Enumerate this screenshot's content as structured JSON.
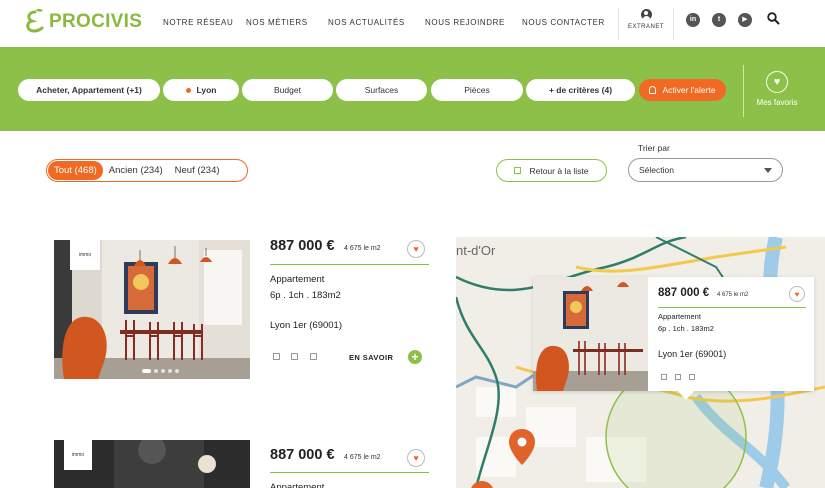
{
  "header": {
    "logo_text": "PROCIVIS",
    "nav": [
      "NOTRE RÉSEAU",
      "NOS MÉTIERS",
      "NOS ACTUALITÉS",
      "NOUS REJOINDRE",
      "NOUS CONTACTER"
    ],
    "extranet_label": "EXTRANET",
    "social_icons": [
      "linkedin-icon",
      "twitter-icon",
      "youtube-icon"
    ],
    "search_icon": "search-icon"
  },
  "filters": {
    "type": "Acheter, Appartement (+1)",
    "city": "Lyon",
    "budget": "Budget",
    "surfaces": "Surfaces",
    "pieces": "Pièces",
    "more": "+ de critères (4)",
    "alert": "Activer l'alerte",
    "favorites": "Mes favoris",
    "accent_color": "#8dc049",
    "alert_color": "#f06a23"
  },
  "toolbar": {
    "segments": [
      "Tout (468)",
      "Ancien (234)",
      "Neuf (234)"
    ],
    "back_to_list": "Retour à la liste",
    "sort_label": "Trier par",
    "sort_value": "Sélection"
  },
  "listings": [
    {
      "price": "887 000 €",
      "price_m2": "4 675 le m2",
      "type": "Appartement",
      "specs": "6p . 1ch . 183m2",
      "city": "Lyon 1er (69001)",
      "more": "EN SAVOIR",
      "agency": "immo"
    },
    {
      "price": "887 000 €",
      "price_m2": "4 675 le m2",
      "type": "Appartement",
      "agency": "immo"
    }
  ],
  "map": {
    "label": "nt-d'Or",
    "popup": {
      "price": "887 000 €",
      "price_m2": "4 675 le m2",
      "type": "Appartement",
      "specs": "6p . 1ch . 183m2",
      "city": "Lyon 1er (69001)"
    }
  }
}
